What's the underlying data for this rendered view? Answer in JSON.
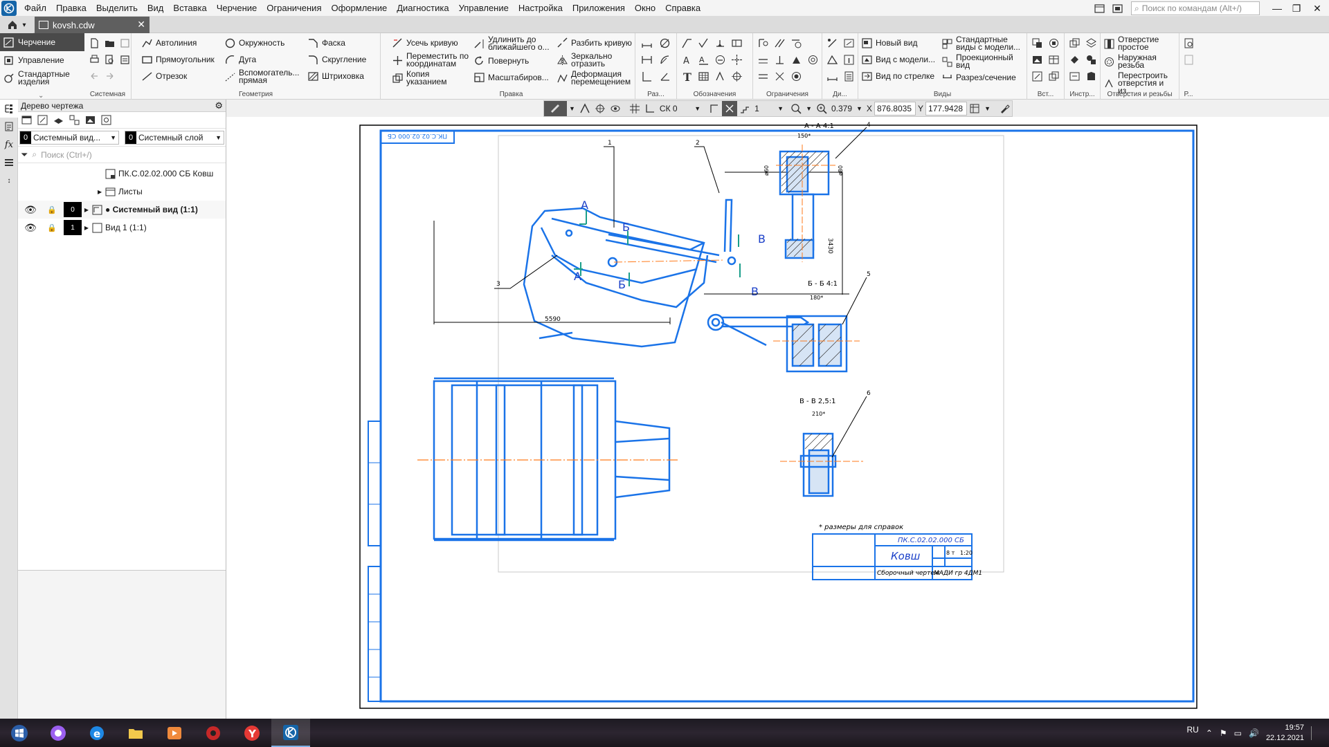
{
  "app": {
    "menu": [
      "Файл",
      "Правка",
      "Выделить",
      "Вид",
      "Вставка",
      "Черчение",
      "Ограничения",
      "Оформление",
      "Диагностика",
      "Управление",
      "Настройка",
      "Приложения",
      "Окно",
      "Справка"
    ],
    "search_placeholder": "Поиск по командам (Alt+/)"
  },
  "document_tab": {
    "title": "kovsh.cdw"
  },
  "ribbon": {
    "mode_tabs": [
      "Черчение",
      "Управление",
      "Стандартные изделия"
    ],
    "groups": {
      "system": "Системная",
      "geometry": "Геометрия",
      "edit": "Правка",
      "dimensions": "Раз...",
      "designations": "Обозначения",
      "constraints": "Ограничения",
      "diagnostics": "Ди...",
      "views": "Виды",
      "insert": "Вст...",
      "tools": "Инстр...",
      "holes": "Отверстия и резьбы",
      "p": "Р..."
    },
    "geometry": {
      "autoline": "Автолиния",
      "rectangle": "Прямоугольник",
      "segment": "Отрезок",
      "circle": "Окружность",
      "arc": "Дуга",
      "aux_line": "Вспомогатель... прямая",
      "chamfer": "Фаска",
      "fillet": "Скругление",
      "hatch": "Штриховка"
    },
    "edit": {
      "trim": "Усечь кривую",
      "move_coords": "Переместить по координатам",
      "copy_pointer": "Копия указанием",
      "extend": "Удлинить до ближайшего о...",
      "rotate": "Повернуть",
      "scale": "Масштабиров...",
      "break": "Разбить кривую",
      "mirror": "Зеркально отразить",
      "deform": "Деформация перемещением"
    },
    "views": {
      "new_view": "Новый вид",
      "model_view": "Вид с модели...",
      "arrow_view": "Вид по стрелке",
      "standard_views": "Стандартные виды с модели...",
      "projection_view": "Проекционный вид",
      "section": "Разрез/сечение"
    },
    "holes": {
      "simple_hole": "Отверстие простое",
      "external_thread": "Наружная резьба",
      "rebuild_holes": "Перестроить отверстия и из..."
    }
  },
  "prop_bar": {
    "cs": "СК 0",
    "step": "1",
    "zoom": "0.379",
    "x_label": "X",
    "x_value": "876.8035",
    "y_label": "Y",
    "y_value": "177.9428"
  },
  "tree": {
    "title": "Дерево чертежа",
    "view_combo": {
      "num": "0",
      "text": "Системный вид..."
    },
    "layer_combo": {
      "num": "0",
      "text": "Системный слой"
    },
    "search_placeholder": "Поиск (Ctrl+/)",
    "root": "ПК.С.02.02.000 СБ Ковш",
    "sheets": "Листы",
    "views": [
      {
        "num": "0",
        "label": "● Системный вид (1:1)"
      },
      {
        "num": "1",
        "label": "Вид 1 (1:1)"
      }
    ]
  },
  "drawing": {
    "top_stamp": "ПК.С.02.02.000 СБ",
    "section_aa": "А - А 4:1",
    "section_bb": "Б - Б 4:1",
    "section_vv": "В - В 2,5:1",
    "labels": {
      "A": "А",
      "B": "Б",
      "V": "В",
      "n1": "1",
      "n2": "2",
      "n3": "3",
      "n4": "4",
      "n5": "5",
      "n6": "6"
    },
    "dim_total_width": "5590",
    "dim_height": "3430",
    "dim_aa_w": "150*",
    "dim_bb_w": "180*",
    "dim_vv_w": "210*",
    "dim_phi1": "ø60",
    "dim_phi2": "ø80",
    "note": "* размеры для справок",
    "title_block": {
      "designation": "ПК.С.02.02.000 СБ",
      "name": "Ковш",
      "doc_type": "Сборочный чертеж",
      "org": "МАДИ гр 4ДМ1",
      "scale": "1:20",
      "mass": "8 т",
      "sheet": "1"
    }
  },
  "taskbar": {
    "lang": "RU",
    "time": "19:57",
    "date": "22.12.2021"
  },
  "colors": {
    "accent": "#1e88e5",
    "drawing_line": "#1a73e8",
    "axis_line": "#ff7a1a",
    "ribbon_bg": "#f7f7f7",
    "active_tab": "#4a4a4a"
  }
}
